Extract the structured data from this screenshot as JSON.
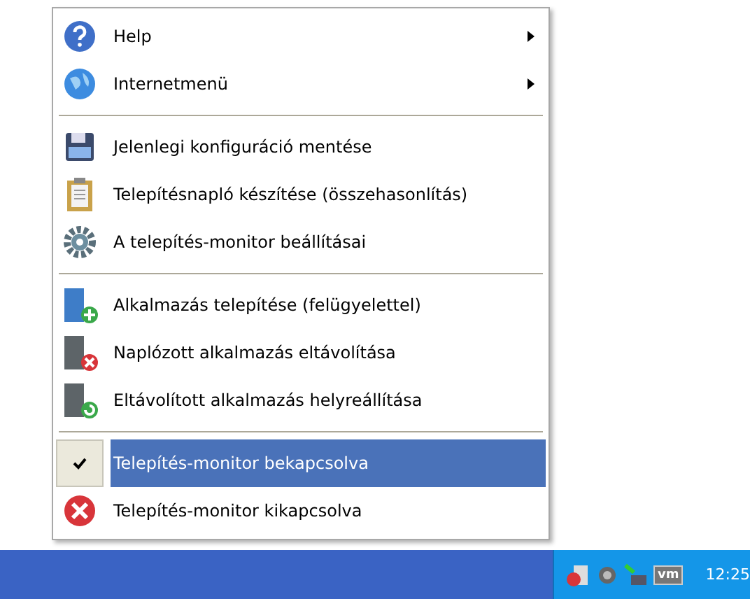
{
  "menu": {
    "groups": [
      {
        "items": [
          {
            "label": "Help",
            "submenu": true,
            "checked": false,
            "selected": false
          },
          {
            "label": "Internetmenü",
            "submenu": true,
            "checked": false,
            "selected": false
          }
        ]
      },
      {
        "items": [
          {
            "label": "Jelenlegi konfiguráció mentése",
            "submenu": false,
            "checked": false,
            "selected": false
          },
          {
            "label": "Telepítésnapló készítése (összehasonlítás)",
            "submenu": false,
            "checked": false,
            "selected": false
          },
          {
            "label": "A telepítés-monitor beállításai",
            "submenu": false,
            "checked": false,
            "selected": false
          }
        ]
      },
      {
        "items": [
          {
            "label": "Alkalmazás telepítése (felügyelettel)",
            "submenu": false,
            "checked": false,
            "selected": false
          },
          {
            "label": "Naplózott alkalmazás eltávolítása",
            "submenu": false,
            "checked": false,
            "selected": false
          },
          {
            "label": "Eltávolított alkalmazás helyreállítása",
            "submenu": false,
            "checked": false,
            "selected": false
          }
        ]
      },
      {
        "items": [
          {
            "label": "Telepítés-monitor bekapcsolva",
            "submenu": false,
            "checked": true,
            "selected": true
          },
          {
            "label": "Telepítés-monitor kikapcsolva",
            "submenu": false,
            "checked": false,
            "selected": false
          }
        ]
      }
    ]
  },
  "taskbar": {
    "tray_logo": "vm",
    "clock": "12:25"
  }
}
